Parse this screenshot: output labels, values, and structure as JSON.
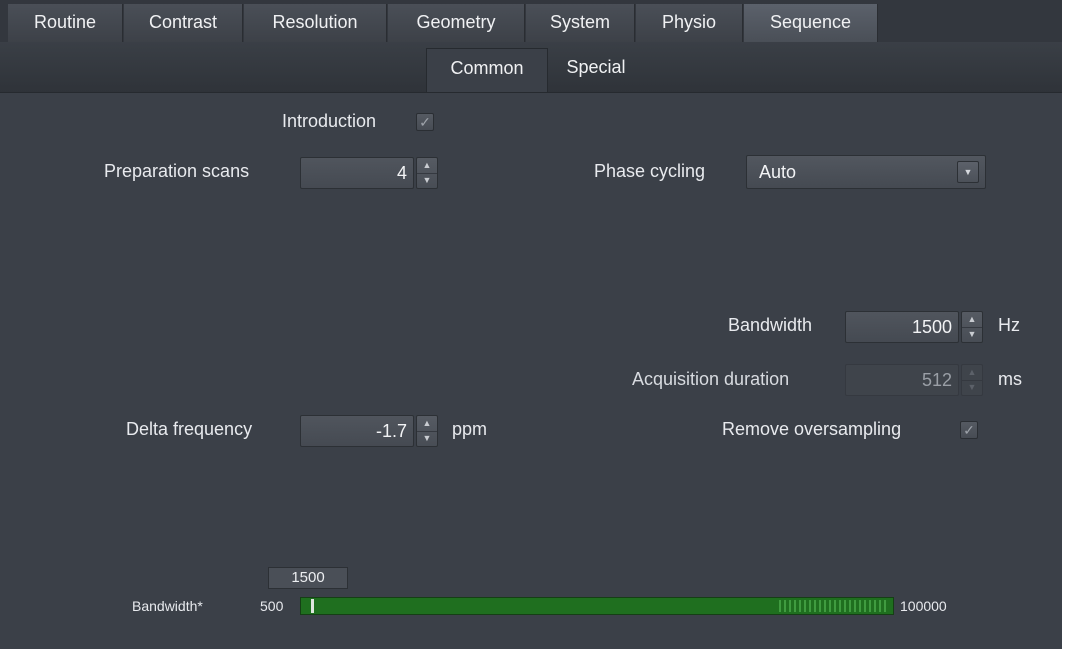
{
  "tabs": [
    {
      "label": "Routine",
      "active": false
    },
    {
      "label": "Contrast",
      "active": false
    },
    {
      "label": "Resolution",
      "active": false
    },
    {
      "label": "Geometry",
      "active": false
    },
    {
      "label": "System",
      "active": false
    },
    {
      "label": "Physio",
      "active": false
    },
    {
      "label": "Sequence",
      "active": true
    }
  ],
  "subtabs": [
    {
      "label": "Common",
      "active": true
    },
    {
      "label": "Special",
      "active": false
    }
  ],
  "form": {
    "introduction": {
      "label": "Introduction",
      "checked": true
    },
    "preparation_scans": {
      "label": "Preparation scans",
      "value": "4"
    },
    "phase_cycling": {
      "label": "Phase cycling",
      "value": "Auto"
    },
    "bandwidth": {
      "label": "Bandwidth",
      "value": "1500",
      "unit": "Hz"
    },
    "acquisition_duration": {
      "label": "Acquisition duration",
      "value": "512",
      "unit": "ms",
      "disabled": true
    },
    "delta_frequency": {
      "label": "Delta frequency",
      "value": "-1.7",
      "unit": "ppm"
    },
    "remove_oversampling": {
      "label": "Remove oversampling",
      "checked": true
    }
  },
  "slider": {
    "label": "Bandwidth*",
    "min_label": "500",
    "max_label": "100000",
    "current_label": "1500",
    "min": 500,
    "max": 100000,
    "value": 1500
  },
  "colors": {
    "panel_bg": "#3b4048",
    "slider_fill": "#1f6f1f"
  },
  "icons": {
    "check": "checkmark-icon",
    "spin_up": "chevron-up-icon",
    "spin_down": "chevron-down-icon",
    "dropdown": "dropdown-arrow-icon"
  }
}
